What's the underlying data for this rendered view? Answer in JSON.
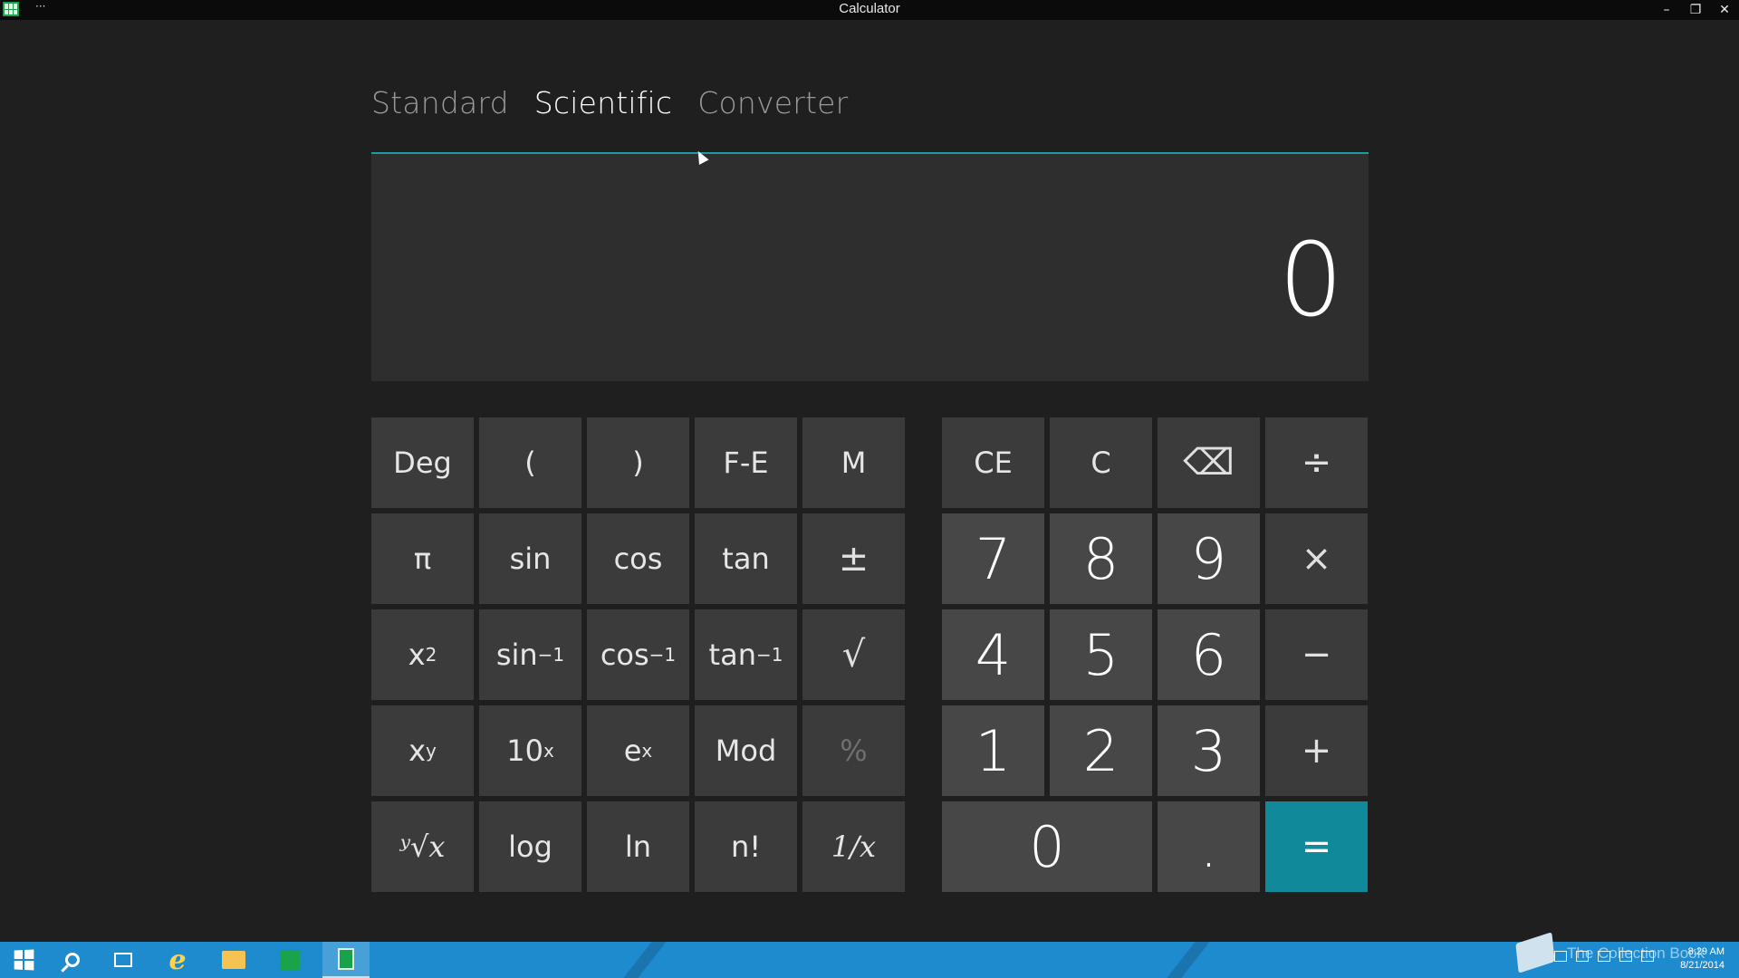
{
  "window": {
    "title": "Calculator",
    "menu_glyph": "···",
    "minimize": "–",
    "restore": "❐",
    "close": "✕"
  },
  "tabs": [
    {
      "label": "Standard",
      "active": false
    },
    {
      "label": "Scientific",
      "active": true
    },
    {
      "label": "Converter",
      "active": false
    }
  ],
  "display": {
    "value": "0"
  },
  "scientific_keys": {
    "deg": "Deg",
    "lparen": "(",
    "rparen": ")",
    "fe": "F-E",
    "m": "M",
    "pi": "π",
    "sin": "sin",
    "cos": "cos",
    "tan": "tan",
    "plusminus": "±",
    "x_base": "x",
    "sq_exp": "2",
    "asin_base": "sin",
    "asin_exp": "−1",
    "acos_base": "cos",
    "acos_exp": "−1",
    "atan_base": "tan",
    "atan_exp": "−1",
    "sqrt": "√",
    "xy_base": "x",
    "xy_exp": "y",
    "ten_base": "10",
    "ten_exp": "x",
    "e_base": "e",
    "e_exp": "x",
    "mod": "Mod",
    "percent": "%",
    "yroot": "ʸ√x",
    "log": "log",
    "ln": "ln",
    "fact": "n!",
    "recip": "1/x"
  },
  "number_keys": {
    "ce": "CE",
    "c": "C",
    "backspace": "⌫",
    "divide": "÷",
    "seven": "7",
    "eight": "8",
    "nine": "9",
    "multiply": "×",
    "four": "4",
    "five": "5",
    "six": "6",
    "minus": "−",
    "one": "1",
    "two": "2",
    "three": "3",
    "plus": "+",
    "zero": "0",
    "decimal": ".",
    "equals": "="
  },
  "taskbar": {
    "watermark": "The Collection Book",
    "time": "8:29 AM",
    "date": "8/21/2014"
  },
  "colors": {
    "accent": "#10899a",
    "taskbar": "#1f8bcf",
    "background": "#1f1f1f"
  }
}
